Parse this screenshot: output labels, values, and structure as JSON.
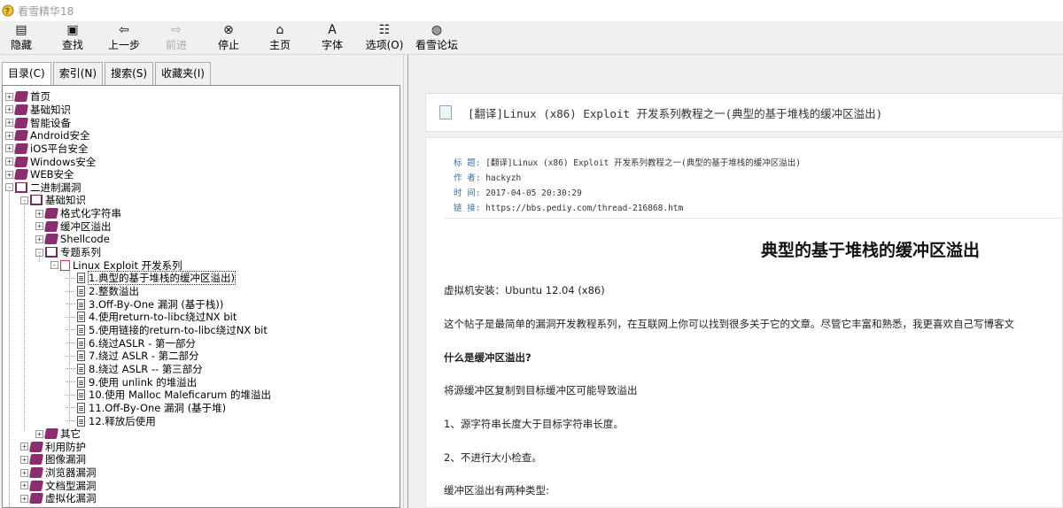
{
  "window": {
    "title": "看雪精华18"
  },
  "toolbar": [
    {
      "key": "hide",
      "label": "隐藏",
      "icon": "hide-icon",
      "glyph": "▤",
      "enabled": true
    },
    {
      "key": "find",
      "label": "查找",
      "icon": "find-icon",
      "glyph": "▣",
      "enabled": true
    },
    {
      "key": "back",
      "label": "上一步",
      "icon": "back-arrow-icon",
      "glyph": "⇦",
      "enabled": true
    },
    {
      "key": "forward",
      "label": "前进",
      "icon": "forward-arrow-icon",
      "glyph": "⇨",
      "enabled": false
    },
    {
      "key": "stop",
      "label": "停止",
      "icon": "stop-icon",
      "glyph": "⊗",
      "enabled": true
    },
    {
      "key": "home",
      "label": "主页",
      "icon": "home-icon",
      "glyph": "⌂",
      "enabled": true
    },
    {
      "key": "font",
      "label": "字体",
      "icon": "font-icon",
      "glyph": "A",
      "enabled": true
    },
    {
      "key": "options",
      "label": "选项(O)",
      "icon": "options-icon",
      "glyph": "☷",
      "enabled": true
    },
    {
      "key": "forum",
      "label": "看雪论坛",
      "icon": "forum-globe-icon",
      "glyph": "◍",
      "enabled": true
    }
  ],
  "nav_tabs": [
    {
      "label": "目录(C)",
      "active": true
    },
    {
      "label": "索引(N)",
      "active": false
    },
    {
      "label": "搜索(S)",
      "active": false
    },
    {
      "label": "收藏夹(I)",
      "active": false
    }
  ],
  "tree": [
    {
      "label": "首页",
      "icon": "book",
      "expander": "+",
      "level": 0
    },
    {
      "label": "基础知识",
      "icon": "book",
      "expander": "+",
      "level": 0
    },
    {
      "label": "智能设备",
      "icon": "book",
      "expander": "+",
      "level": 0
    },
    {
      "label": "Android安全",
      "icon": "book",
      "expander": "+",
      "level": 0
    },
    {
      "label": "iOS平台安全",
      "icon": "book",
      "expander": "+",
      "level": 0
    },
    {
      "label": "Windows安全",
      "icon": "book",
      "expander": "+",
      "level": 0
    },
    {
      "label": "WEB安全",
      "icon": "book",
      "expander": "+",
      "level": 0
    },
    {
      "label": "二进制漏洞",
      "icon": "openbook",
      "expander": "-",
      "level": 0
    },
    {
      "label": "基础知识",
      "icon": "openbook",
      "expander": "-",
      "level": 1
    },
    {
      "label": "格式化字符串",
      "icon": "book",
      "expander": "+",
      "level": 2
    },
    {
      "label": "缓冲区溢出",
      "icon": "book",
      "expander": "+",
      "level": 2
    },
    {
      "label": "Shellcode",
      "icon": "book",
      "expander": "+",
      "level": 2
    },
    {
      "label": "专题系列",
      "icon": "openbook",
      "expander": "-",
      "level": 2
    },
    {
      "label": "Linux Exploit 开发系列",
      "icon": "bookdoc",
      "expander": "-",
      "level": 3
    },
    {
      "label": "1.典型的基于堆栈的缓冲区溢出)",
      "icon": "page",
      "expander": "",
      "level": 4,
      "selected": true
    },
    {
      "label": "2.整数溢出",
      "icon": "page",
      "expander": "",
      "level": 4
    },
    {
      "label": "3.Off-By-One 漏洞 (基于栈))",
      "icon": "page",
      "expander": "",
      "level": 4
    },
    {
      "label": "4.使用return-to-libc绕过NX bit",
      "icon": "page",
      "expander": "",
      "level": 4
    },
    {
      "label": "5.使用链接的return-to-libc绕过NX bit",
      "icon": "page",
      "expander": "",
      "level": 4
    },
    {
      "label": "6.绕过ASLR - 第一部分",
      "icon": "page",
      "expander": "",
      "level": 4
    },
    {
      "label": "7.绕过 ASLR - 第二部分",
      "icon": "page",
      "expander": "",
      "level": 4
    },
    {
      "label": "8.绕过 ASLR -- 第三部分",
      "icon": "page",
      "expander": "",
      "level": 4
    },
    {
      "label": "9.使用 unlink 的堆溢出",
      "icon": "page",
      "expander": "",
      "level": 4
    },
    {
      "label": "10.使用 Malloc Maleficarum 的堆溢出",
      "icon": "page",
      "expander": "",
      "level": 4
    },
    {
      "label": "11.Off-By-One 漏洞 (基于堆)",
      "icon": "page",
      "expander": "",
      "level": 4
    },
    {
      "label": "12.释放后使用",
      "icon": "page",
      "expander": "",
      "level": 4
    },
    {
      "label": "其它",
      "icon": "book",
      "expander": "+",
      "level": 2
    },
    {
      "label": "利用防护",
      "icon": "book",
      "expander": "+",
      "level": 1
    },
    {
      "label": "图像漏洞",
      "icon": "book",
      "expander": "+",
      "level": 1
    },
    {
      "label": "浏览器漏洞",
      "icon": "book",
      "expander": "+",
      "level": 1
    },
    {
      "label": "文档型漏洞",
      "icon": "book",
      "expander": "+",
      "level": 1
    },
    {
      "label": "虚拟化漏洞",
      "icon": "book",
      "expander": "+",
      "level": 1
    }
  ],
  "doc_header": {
    "title": "[翻译]Linux (x86) Exploit 开发系列教程之一(典型的基于堆栈的缓冲区溢出)"
  },
  "meta": [
    {
      "key": "标 题:",
      "value": "[翻译]Linux (x86) Exploit 开发系列教程之一(典型的基于堆栈的缓冲区溢出)"
    },
    {
      "key": "作 者:",
      "value": "hackyzh"
    },
    {
      "key": "时 间:",
      "value": "2017-04-05 20:30:29"
    },
    {
      "key": "链 接:",
      "value": "https://bbs.pediy.com/thread-216868.htm"
    }
  ],
  "article": {
    "title": "典型的基于堆栈的缓冲区溢出",
    "paragraphs": [
      {
        "text": "虚拟机安装：Ubuntu 12.04 (x86)",
        "bold": false
      },
      {
        "text": "这个帖子是最简单的漏洞开发教程系列，在互联网上你可以找到很多关于它的文章。尽管它丰富和熟悉，我更喜欢自己写博客文",
        "bold": false
      },
      {
        "text": "什么是缓冲区溢出?",
        "bold": true
      },
      {
        "text": "将源缓冲区复制到目标缓冲区可能导致溢出",
        "bold": false
      },
      {
        "text": "1、源字符串长度大于目标字符串长度。",
        "bold": false
      },
      {
        "text": "2、不进行大小检查。",
        "bold": false
      },
      {
        "text": "缓冲区溢出有两种类型:",
        "bold": false
      }
    ]
  }
}
